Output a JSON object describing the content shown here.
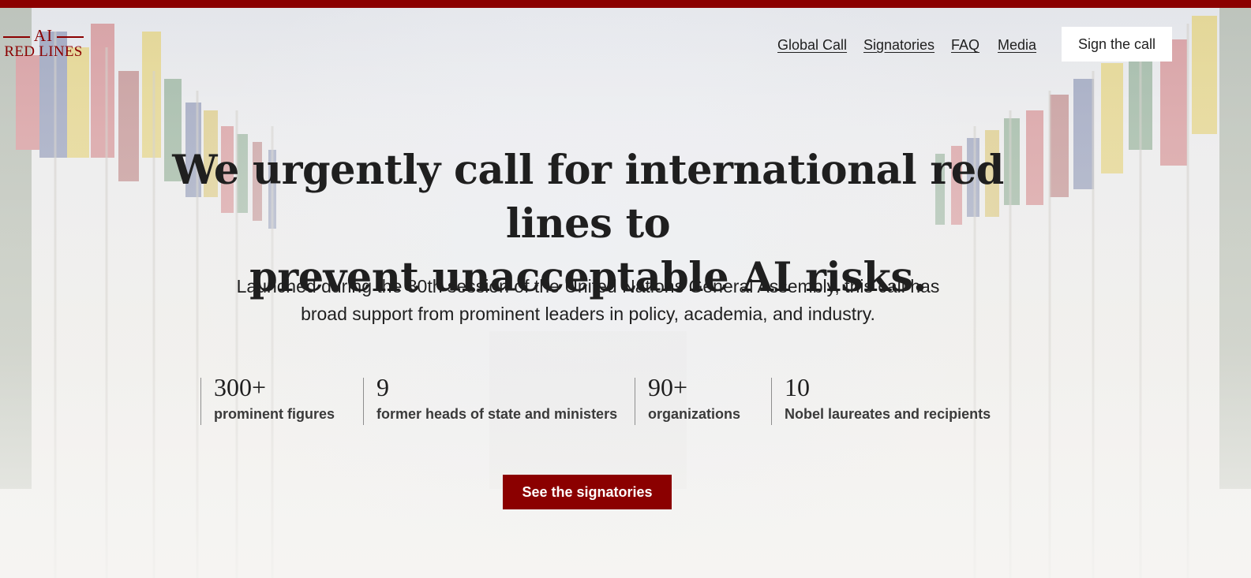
{
  "brand": {
    "logo_top": "AI",
    "logo_bottom": "RED LINES",
    "accent_color": "#8b0000"
  },
  "nav": {
    "items": [
      {
        "label": "Global Call"
      },
      {
        "label": "Signatories"
      },
      {
        "label": "FAQ"
      },
      {
        "label": "Media"
      }
    ],
    "cta_label": "Sign the call"
  },
  "hero": {
    "headline_line1": "We urgently call for international red lines to",
    "headline_line2": "prevent unacceptable AI risks.",
    "subtext_line1": "Launched during the 80th session of the United Nations General Assembly, this call has",
    "subtext_line2": "broad support from prominent leaders in policy, academia, and industry."
  },
  "stats": [
    {
      "value": "300+",
      "label": "prominent figures"
    },
    {
      "value": "9",
      "label": "former heads of state and ministers"
    },
    {
      "value": "90+",
      "label": "organizations"
    },
    {
      "value": "10",
      "label": "Nobel laureates and recipients"
    }
  ],
  "cta": {
    "label": "See the signatories"
  }
}
